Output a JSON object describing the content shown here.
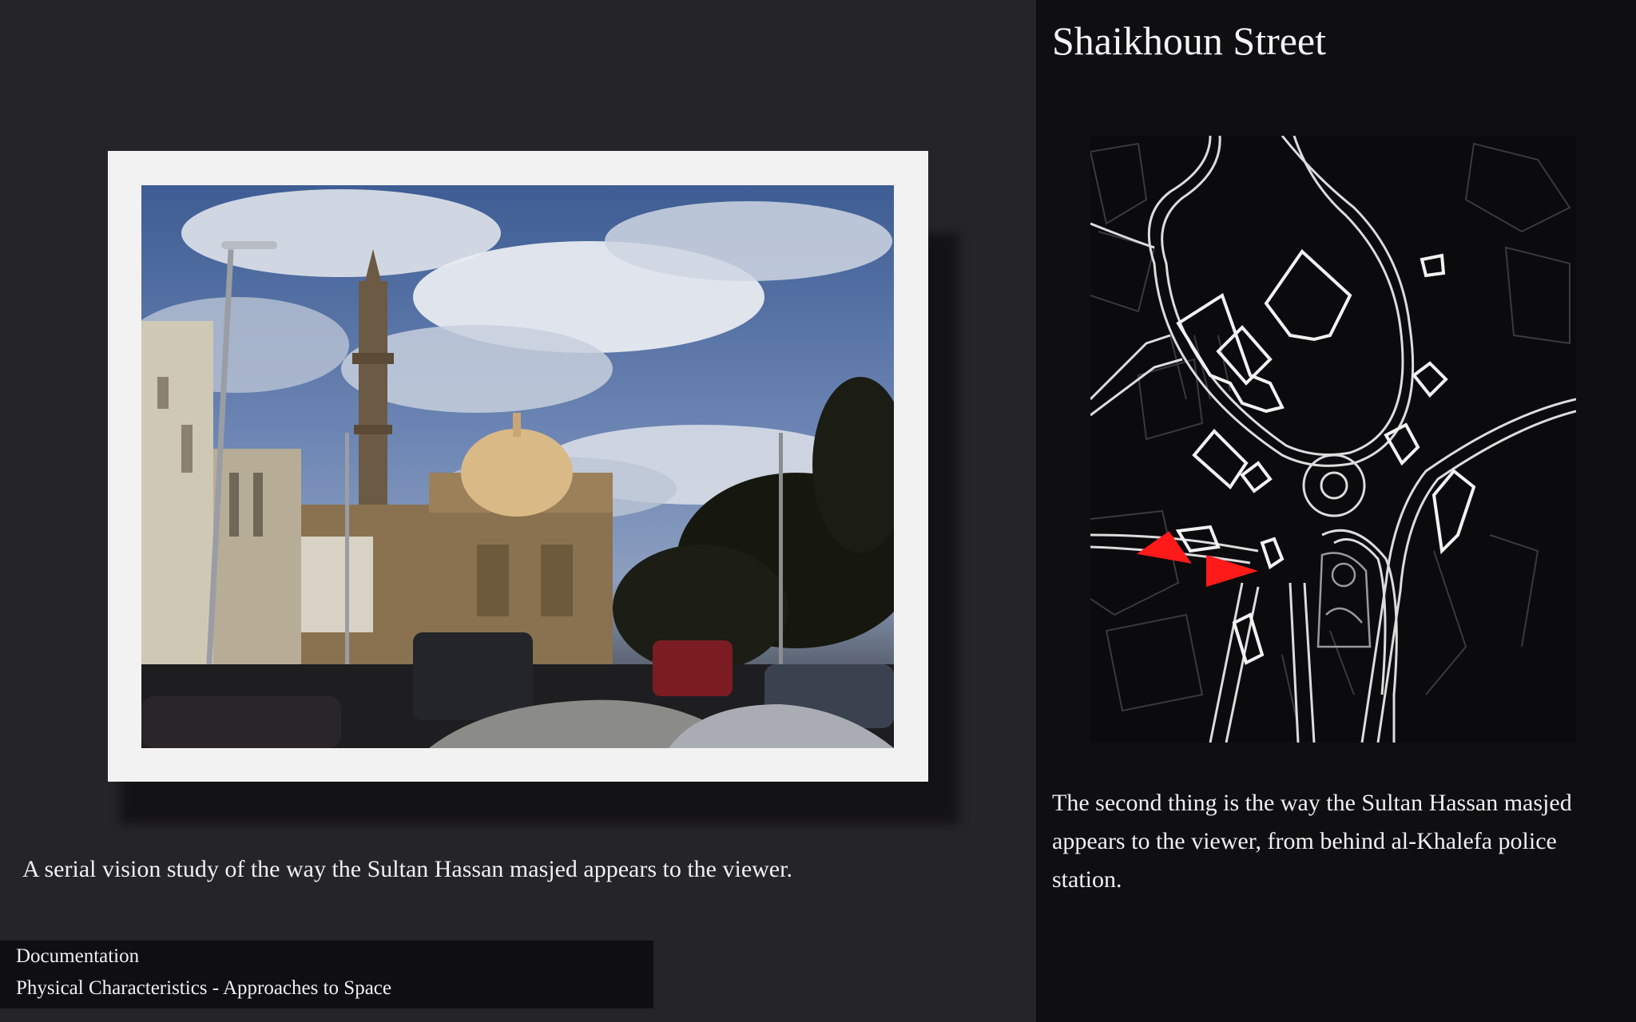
{
  "slide": {
    "title": "Shaikhoun Street",
    "photo_caption": "A serial vision study of the way the Sultan Hassan masjed appears to the viewer.",
    "map_caption": "The second thing is the way the Sultan Hassan masjed appears to the viewer, from behind al-Khalefa police station."
  },
  "footer": {
    "section": "Documentation",
    "subsection": "Physical Characteristics - Approaches to Space"
  },
  "colors": {
    "background": "#252427",
    "panel": "#0f0e10",
    "arrow": "#ff1a1a"
  },
  "icons": {
    "view_arrows": "red-triangle-arrow"
  }
}
